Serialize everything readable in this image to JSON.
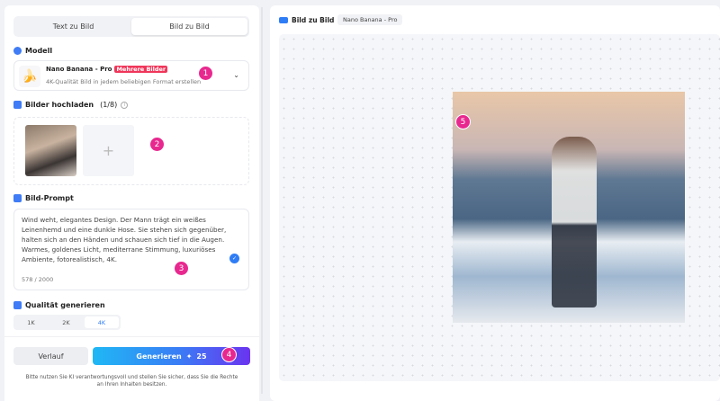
{
  "tabs": {
    "text_to_image": "Text zu Bild",
    "image_to_image": "Bild zu Bild",
    "active": "image_to_image"
  },
  "model": {
    "label": "Modell",
    "name": "Nano Banana - Pro",
    "badge": "Mehrere Bilder",
    "description": "4K-Qualität Bild in jedem beliebigen Format erstellen",
    "icon": "banana-icon"
  },
  "upload": {
    "label": "Bilder hochladen",
    "count": "(1/8)",
    "add_icon": "plus-icon"
  },
  "prompt": {
    "label": "Bild-Prompt",
    "text": "Wind weht, elegantes Design. Der Mann trägt ein weißes Leinenhemd und eine dunkle Hose. Sie stehen sich gegenüber, halten sich an den Händen und schauen sich tief in die Augen. Warmes, goldenes Licht, mediterrane Stimmung, luxuriöses Ambiente, fotorealistisch, 4K.",
    "counter": "578 / 2000"
  },
  "quality": {
    "label": "Qualität generieren",
    "options": [
      "1K",
      "2K",
      "4K"
    ],
    "selected": "4K"
  },
  "footer": {
    "history": "Verlauf",
    "generate": "Generieren",
    "credits": "25",
    "disclaimer_1": "Bitte nutzen Sie KI verantwortungsvoll und stellen Sie sicher, dass Sie die Rechte",
    "disclaimer_2": "an Ihren Inhalten besitzen."
  },
  "result": {
    "title": "Bild zu Bild",
    "model_chip": "Nano Banana - Pro"
  },
  "markers": [
    "1",
    "2",
    "3",
    "4",
    "5"
  ],
  "colors": {
    "accent": "#2f7df6",
    "marker": "#e8288f",
    "badge": "#f0365a",
    "generate_start": "#1fb8f5",
    "generate_end": "#6a34f0"
  }
}
